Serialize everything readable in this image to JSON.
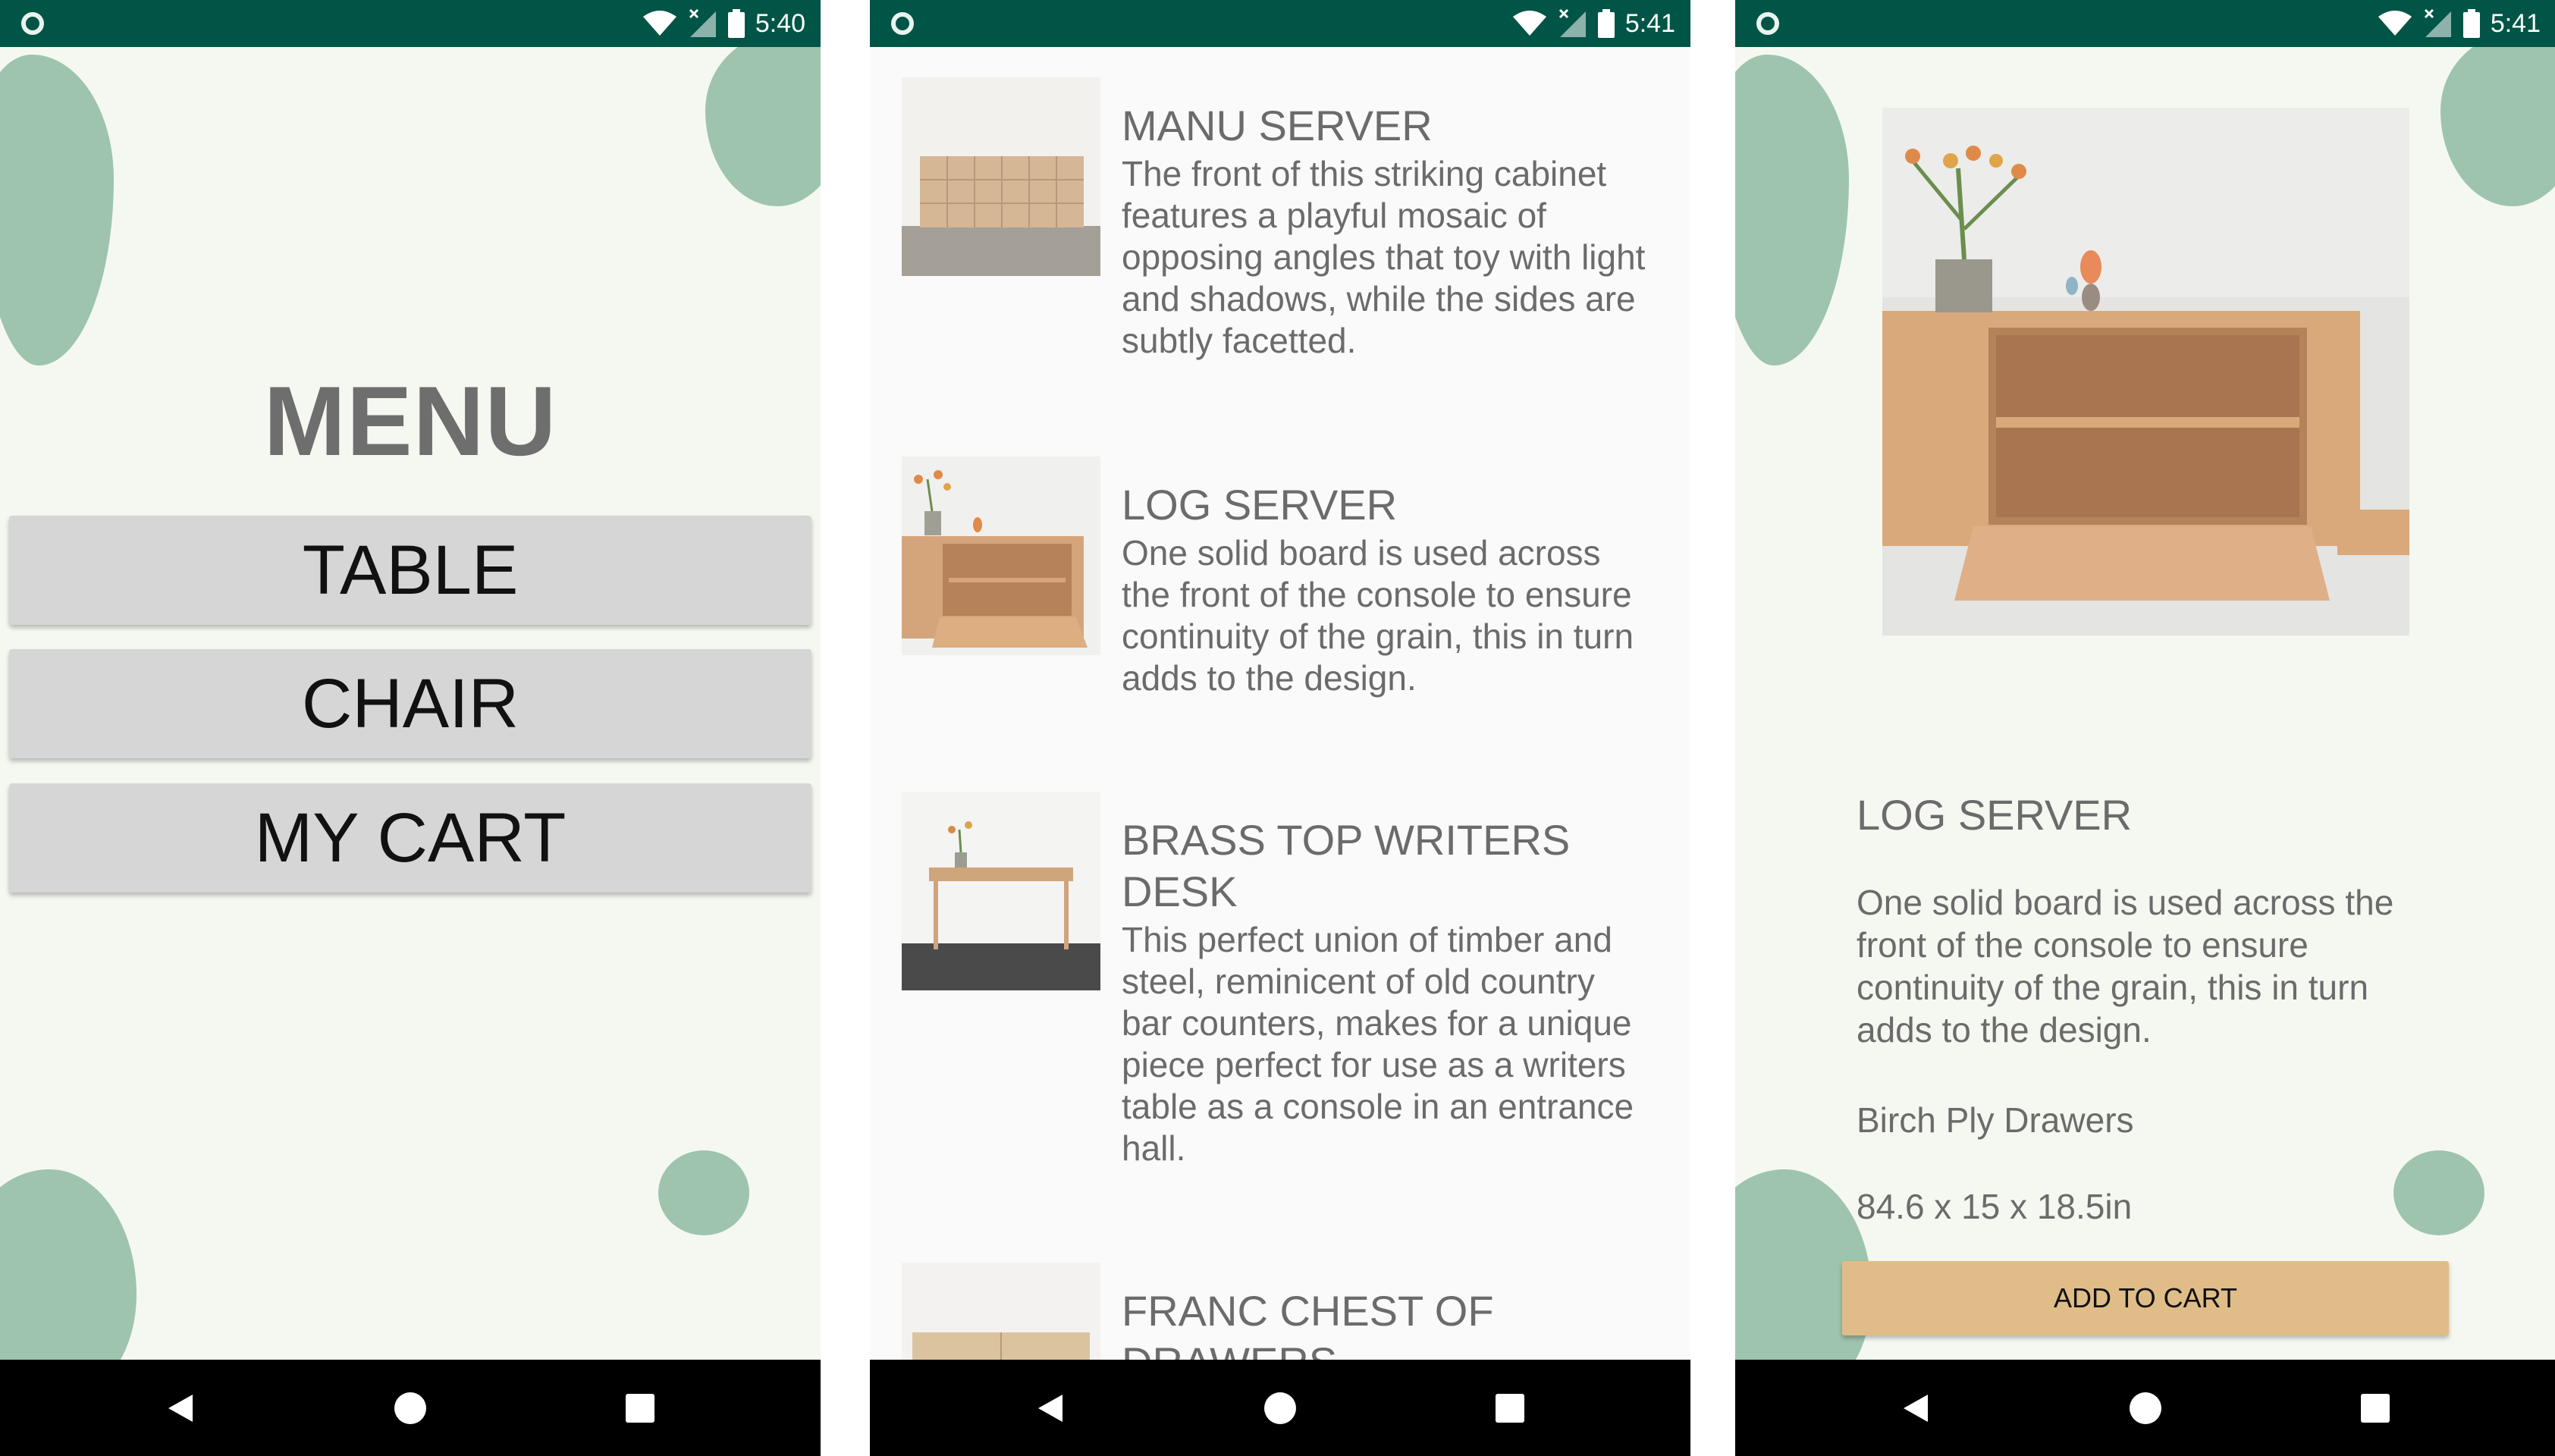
{
  "status_bars": [
    {
      "time": "5:40"
    },
    {
      "time": "5:41"
    },
    {
      "time": "5:41"
    }
  ],
  "menu_screen": {
    "title": "MENU",
    "buttons": [
      {
        "label": "TABLE"
      },
      {
        "label": "CHAIR"
      },
      {
        "label": "MY CART"
      }
    ]
  },
  "list_screen": {
    "items": [
      {
        "title": "MANU SERVER",
        "description": "The front of this striking cabinet features a playful mosaic of opposing angles that toy with light and shadows, while the sides are subtly facetted."
      },
      {
        "title": "LOG SERVER",
        "description": "One solid board is used across the front of the console to ensure continuity of the grain, this in turn adds to the design."
      },
      {
        "title": "BRASS TOP WRITERS DESK",
        "description": "This perfect union of timber and steel, reminicent of old country bar counters, makes for a unique piece perfect for use as a writers table as a console in an entrance hall."
      },
      {
        "title": "FRANC CHEST OF DRAWERS",
        "description": ""
      }
    ]
  },
  "detail_screen": {
    "title": "LOG SERVER",
    "description": "One solid board is used across the front of the console to ensure continuity of the grain, this in turn adds to the design.",
    "material": "Birch Ply Drawers",
    "dimensions": "84.6 x 15 x 18.5in",
    "add_to_cart_label": "ADD TO CART"
  },
  "colors": {
    "status_bar": "#005546",
    "screen_background": "#f5f8f1",
    "blob": "#9ec4ad",
    "menu_button": "#d6d6d6",
    "menu_title": "#6e6e6e",
    "add_to_cart": "#e0bd88",
    "text": "#6b6b6b",
    "nav_bar": "#000000"
  },
  "icons": {
    "status": [
      "app-indicator-icon",
      "wifi-icon",
      "signal-icon",
      "battery-icon"
    ],
    "nav": [
      "back-icon",
      "home-icon",
      "recents-icon"
    ]
  }
}
